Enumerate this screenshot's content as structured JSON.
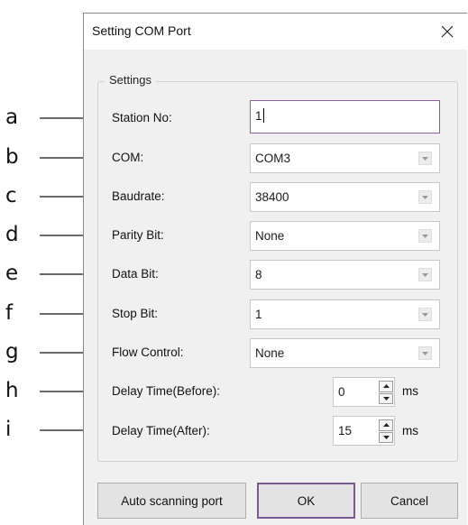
{
  "annotations": [
    "a",
    "b",
    "c",
    "d",
    "e",
    "f",
    "g",
    "h",
    "i"
  ],
  "dialog": {
    "title": "Setting COM Port",
    "close_icon": "close-icon",
    "group_title": "Settings",
    "fields": {
      "station_no": {
        "label": "Station No:",
        "value": "1"
      },
      "com": {
        "label": "COM:",
        "value": "COM3"
      },
      "baudrate": {
        "label": "Baudrate:",
        "value": "38400"
      },
      "parity_bit": {
        "label": "Parity Bit:",
        "value": "None"
      },
      "data_bit": {
        "label": "Data Bit:",
        "value": "8"
      },
      "stop_bit": {
        "label": "Stop Bit:",
        "value": "1"
      },
      "flow_control": {
        "label": "Flow Control:",
        "value": "None"
      },
      "delay_before": {
        "label": "Delay Time(Before):",
        "value": "0",
        "unit": "ms"
      },
      "delay_after": {
        "label": "Delay Time(After):",
        "value": "15",
        "unit": "ms"
      }
    },
    "buttons": {
      "auto_scan": "Auto scanning port",
      "ok": "OK",
      "cancel": "Cancel"
    }
  },
  "colors": {
    "dialog_bg": "#f0f0f0",
    "focus_border": "#8b5f9c",
    "default_button_border": "#7a5a95"
  }
}
